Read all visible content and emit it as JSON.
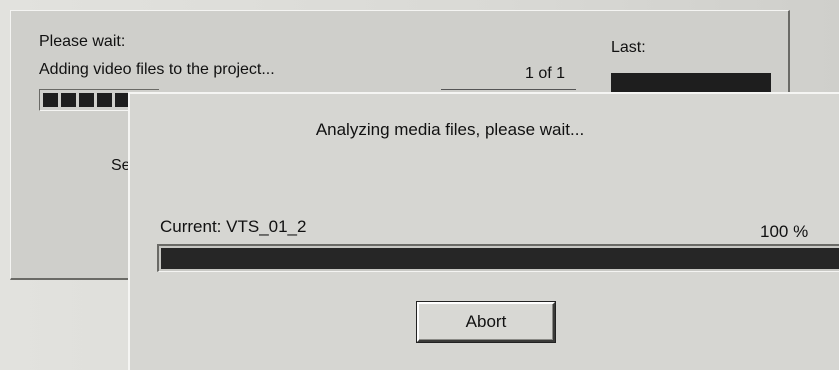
{
  "back_dialog": {
    "wait_text": "Please wait:",
    "adding_text": "Adding video files to the project...",
    "count_text": "1 of 1",
    "last_label": "Last:",
    "status_partial": "Se",
    "progress_fraction": 0.3
  },
  "front_dialog": {
    "message": "Analyzing media files, please wait...",
    "current_label": "Current: VTS_01_2",
    "percent_label": "100 %",
    "progress_fraction": 1.0,
    "abort_label": "Abort"
  },
  "colors": {
    "dialog_face": "#d6d6d2",
    "progress_fill": "#262626"
  }
}
